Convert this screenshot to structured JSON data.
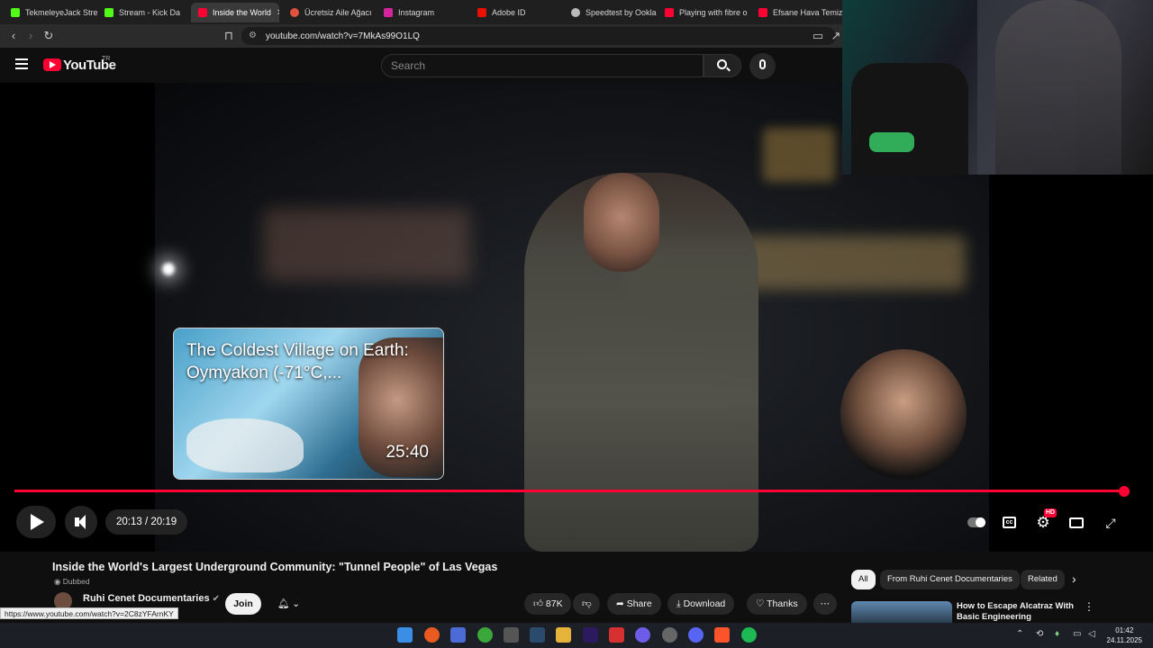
{
  "tabs": [
    {
      "title": "TekmeleyeJack Stre",
      "color": "#53fc18"
    },
    {
      "title": "Stream - Kick Da",
      "color": "#53fc18"
    },
    {
      "title": "Inside the World",
      "color": "#ff0033",
      "active": true
    },
    {
      "title": "Ücretsiz Aile Ağacı",
      "color": "#e0533d"
    },
    {
      "title": "Instagram",
      "color": "#d6249f"
    },
    {
      "title": "Adobe ID",
      "color": "#eb1000"
    },
    {
      "title": "Speedtest by Ookla",
      "color": "#bbbbbb"
    },
    {
      "title": "Playing with fibre o",
      "color": "#ff0033"
    },
    {
      "title": "Efsane Hava Temizle",
      "color": "#ff0033"
    }
  ],
  "address": {
    "url": "youtube.com/watch?v=7MkAs99O1LQ"
  },
  "youtube": {
    "logo": "YouTube",
    "region": "TR",
    "search_placeholder": "Search"
  },
  "player": {
    "card_title": "The Coldest Village on Earth: Oymyakon (-71°C,...",
    "card_duration": "25:40",
    "time": "20:13 / 20:19",
    "quality_badge": "HD",
    "progress": 1.0
  },
  "video": {
    "title": "Inside the World's Largest Underground Community: \"Tunnel People\" of Las Vegas",
    "dubbed": "Dubbed",
    "channel": "Ruhi Cenet Documentaries",
    "join": "Join",
    "likes": "87K",
    "share": "Share",
    "download": "Download",
    "thanks": "Thanks"
  },
  "sidebar": {
    "chips": [
      "All",
      "From Ruhi Cenet Documentaries",
      "Related"
    ],
    "next_title": "How to Escape Alcatraz With Basic Engineering"
  },
  "status_url": "https://www.youtube.com/watch?v=2C8zYFArnKY",
  "clock": {
    "time": "01:42",
    "date": "24.11.2025"
  }
}
